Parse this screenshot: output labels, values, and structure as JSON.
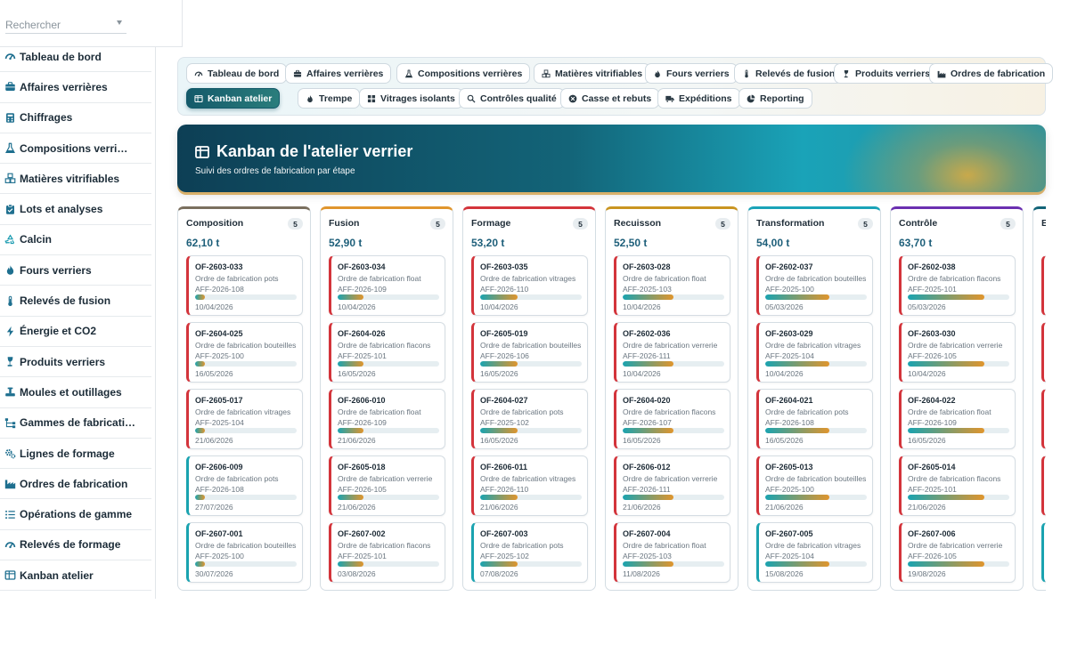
{
  "search": {
    "placeholder": "Rechercher"
  },
  "sidebar": {
    "items": [
      {
        "label": "Tableau de bord",
        "icon": "gauge-icon"
      },
      {
        "label": "Affaires verrières",
        "icon": "briefcase-icon"
      },
      {
        "label": "Chiffrages",
        "icon": "calculator-icon"
      },
      {
        "label": "Compositions verri…",
        "icon": "flask-icon"
      },
      {
        "label": "Matières vitrifiables",
        "icon": "cubes-icon"
      },
      {
        "label": "Lots et analyses",
        "icon": "clipboard-icon"
      },
      {
        "label": "Calcin",
        "icon": "recycle-icon"
      },
      {
        "label": "Fours verriers",
        "icon": "flame-icon"
      },
      {
        "label": "Relevés de fusion",
        "icon": "thermometer-icon"
      },
      {
        "label": "Énergie et CO2",
        "icon": "bolt-icon"
      },
      {
        "label": "Produits verriers",
        "icon": "wine-glass-icon"
      },
      {
        "label": "Moules et outillages",
        "icon": "tools-icon"
      },
      {
        "label": "Gammes de fabricati…",
        "icon": "sitemap-icon"
      },
      {
        "label": "Lignes de formage",
        "icon": "gears-icon"
      },
      {
        "label": "Ordres de fabrication",
        "icon": "industry-icon"
      },
      {
        "label": "Opérations de gamme",
        "icon": "list-icon"
      },
      {
        "label": "Relevés de formage",
        "icon": "gauge-icon"
      },
      {
        "label": "Kanban atelier",
        "icon": "kanban-icon"
      }
    ]
  },
  "tabs": [
    {
      "label": "Tableau de bord",
      "icon": "gauge-icon",
      "active": false
    },
    {
      "label": "Affaires verrières",
      "icon": "briefcase-icon",
      "active": false
    },
    {
      "label": "Compositions verrières",
      "icon": "flask-icon",
      "active": false
    },
    {
      "label": "Matières vitrifiables",
      "icon": "cubes-icon",
      "active": false
    },
    {
      "label": "Fours verriers",
      "icon": "flame-icon",
      "active": false
    },
    {
      "label": "Relevés de fusion",
      "icon": "thermometer-icon",
      "active": false
    },
    {
      "label": "Produits verriers",
      "icon": "wine-glass-icon",
      "active": false
    },
    {
      "label": "Ordres de fabrication",
      "icon": "industry-icon",
      "active": false
    },
    {
      "label": "Kanban atelier",
      "icon": "kanban-icon",
      "active": true
    },
    {
      "label": "Trempe",
      "icon": "flame-icon",
      "active": false
    },
    {
      "label": "Vitrages isolants",
      "icon": "grid-icon",
      "active": false
    },
    {
      "label": "Contrôles qualité",
      "icon": "search-icon",
      "active": false
    },
    {
      "label": "Casse et rebuts",
      "icon": "x-circle-icon",
      "active": false
    },
    {
      "label": "Expéditions",
      "icon": "truck-icon",
      "active": false
    },
    {
      "label": "Reporting",
      "icon": "pie-icon",
      "active": false
    }
  ],
  "hero": {
    "title": "Kanban de l'atelier verrier",
    "subtitle": "Suivi des ordres de fabrication par étape"
  },
  "columns": [
    {
      "name": "Composition",
      "count": "5",
      "total": "62,10 t",
      "color": "#7a6f5e",
      "cards": [
        {
          "id": "OF-2603-033",
          "desc": "Ordre de fabrication pots",
          "aff": "AFF-2026-108",
          "date": "10/04/2026",
          "status": "red",
          "progress": 0.1
        },
        {
          "id": "OF-2604-025",
          "desc": "Ordre de fabrication bouteilles",
          "aff": "AFF-2025-100",
          "date": "16/05/2026",
          "status": "red",
          "progress": 0.1
        },
        {
          "id": "OF-2605-017",
          "desc": "Ordre de fabrication vitrages",
          "aff": "AFF-2025-104",
          "date": "21/06/2026",
          "status": "red",
          "progress": 0.1
        },
        {
          "id": "OF-2606-009",
          "desc": "Ordre de fabrication pots",
          "aff": "AFF-2026-108",
          "date": "27/07/2026",
          "status": "teal",
          "progress": 0.1
        },
        {
          "id": "OF-2607-001",
          "desc": "Ordre de fabrication bouteilles",
          "aff": "AFF-2025-100",
          "date": "30/07/2026",
          "status": "teal",
          "progress": 0.1
        }
      ]
    },
    {
      "name": "Fusion",
      "count": "5",
      "total": "52,90 t",
      "color": "#e0952d",
      "cards": [
        {
          "id": "OF-2603-034",
          "desc": "Ordre de fabrication float",
          "aff": "AFF-2026-109",
          "date": "10/04/2026",
          "status": "red",
          "progress": 0.25
        },
        {
          "id": "OF-2604-026",
          "desc": "Ordre de fabrication flacons",
          "aff": "AFF-2025-101",
          "date": "16/05/2026",
          "status": "red",
          "progress": 0.25
        },
        {
          "id": "OF-2606-010",
          "desc": "Ordre de fabrication float",
          "aff": "AFF-2026-109",
          "date": "21/06/2026",
          "status": "red",
          "progress": 0.25
        },
        {
          "id": "OF-2605-018",
          "desc": "Ordre de fabrication verrerie",
          "aff": "AFF-2026-105",
          "date": "21/06/2026",
          "status": "red",
          "progress": 0.25
        },
        {
          "id": "OF-2607-002",
          "desc": "Ordre de fabrication flacons",
          "aff": "AFF-2025-101",
          "date": "03/08/2026",
          "status": "red",
          "progress": 0.25
        }
      ]
    },
    {
      "name": "Formage",
      "count": "5",
      "total": "53,20 t",
      "color": "#d3343b",
      "cards": [
        {
          "id": "OF-2603-035",
          "desc": "Ordre de fabrication vitrages",
          "aff": "AFF-2026-110",
          "date": "10/04/2026",
          "status": "red",
          "progress": 0.37
        },
        {
          "id": "OF-2605-019",
          "desc": "Ordre de fabrication bouteilles",
          "aff": "AFF-2026-106",
          "date": "16/05/2026",
          "status": "red",
          "progress": 0.37
        },
        {
          "id": "OF-2604-027",
          "desc": "Ordre de fabrication pots",
          "aff": "AFF-2025-102",
          "date": "16/05/2026",
          "status": "red",
          "progress": 0.37
        },
        {
          "id": "OF-2606-011",
          "desc": "Ordre de fabrication vitrages",
          "aff": "AFF-2026-110",
          "date": "21/06/2026",
          "status": "red",
          "progress": 0.37
        },
        {
          "id": "OF-2607-003",
          "desc": "Ordre de fabrication pots",
          "aff": "AFF-2025-102",
          "date": "07/08/2026",
          "status": "teal",
          "progress": 0.37
        }
      ]
    },
    {
      "name": "Recuisson",
      "count": "5",
      "total": "52,50 t",
      "color": "#c99420",
      "cards": [
        {
          "id": "OF-2603-028",
          "desc": "Ordre de fabrication float",
          "aff": "AFF-2025-103",
          "date": "10/04/2026",
          "status": "red",
          "progress": 0.5
        },
        {
          "id": "OF-2602-036",
          "desc": "Ordre de fabrication verrerie",
          "aff": "AFF-2026-111",
          "date": "10/04/2026",
          "status": "red",
          "progress": 0.5
        },
        {
          "id": "OF-2604-020",
          "desc": "Ordre de fabrication flacons",
          "aff": "AFF-2026-107",
          "date": "16/05/2026",
          "status": "red",
          "progress": 0.5
        },
        {
          "id": "OF-2606-012",
          "desc": "Ordre de fabrication verrerie",
          "aff": "AFF-2026-111",
          "date": "21/06/2026",
          "status": "red",
          "progress": 0.5
        },
        {
          "id": "OF-2607-004",
          "desc": "Ordre de fabrication float",
          "aff": "AFF-2025-103",
          "date": "11/08/2026",
          "status": "red",
          "progress": 0.5
        }
      ]
    },
    {
      "name": "Transformation",
      "count": "5",
      "total": "54,00 t",
      "color": "#1aa3b8",
      "cards": [
        {
          "id": "OF-2602-037",
          "desc": "Ordre de fabrication bouteilles",
          "aff": "AFF-2025-100",
          "date": "05/03/2026",
          "status": "red",
          "progress": 0.63
        },
        {
          "id": "OF-2603-029",
          "desc": "Ordre de fabrication vitrages",
          "aff": "AFF-2025-104",
          "date": "10/04/2026",
          "status": "red",
          "progress": 0.63
        },
        {
          "id": "OF-2604-021",
          "desc": "Ordre de fabrication pots",
          "aff": "AFF-2026-108",
          "date": "16/05/2026",
          "status": "red",
          "progress": 0.63
        },
        {
          "id": "OF-2605-013",
          "desc": "Ordre de fabrication bouteilles",
          "aff": "AFF-2025-100",
          "date": "21/06/2026",
          "status": "red",
          "progress": 0.63
        },
        {
          "id": "OF-2607-005",
          "desc": "Ordre de fabrication vitrages",
          "aff": "AFF-2025-104",
          "date": "15/08/2026",
          "status": "teal",
          "progress": 0.63
        }
      ]
    },
    {
      "name": "Contrôle",
      "count": "5",
      "total": "63,70 t",
      "color": "#6a2fb0",
      "cards": [
        {
          "id": "OF-2602-038",
          "desc": "Ordre de fabrication flacons",
          "aff": "AFF-2025-101",
          "date": "05/03/2026",
          "status": "red",
          "progress": 0.75
        },
        {
          "id": "OF-2603-030",
          "desc": "Ordre de fabrication verrerie",
          "aff": "AFF-2026-105",
          "date": "10/04/2026",
          "status": "red",
          "progress": 0.75
        },
        {
          "id": "OF-2604-022",
          "desc": "Ordre de fabrication float",
          "aff": "AFF-2026-109",
          "date": "16/05/2026",
          "status": "red",
          "progress": 0.75
        },
        {
          "id": "OF-2605-014",
          "desc": "Ordre de fabrication flacons",
          "aff": "AFF-2025-101",
          "date": "21/06/2026",
          "status": "red",
          "progress": 0.75
        },
        {
          "id": "OF-2607-006",
          "desc": "Ordre de fabrication verrerie",
          "aff": "AFF-2026-105",
          "date": "19/08/2026",
          "status": "red",
          "progress": 0.75
        }
      ]
    },
    {
      "name": "E",
      "count": "",
      "total": "",
      "color": "#136478",
      "cards": [
        {
          "id": "",
          "desc": "",
          "aff": "",
          "date": "",
          "status": "red",
          "progress": 0
        },
        {
          "id": "",
          "desc": "",
          "aff": "",
          "date": "",
          "status": "red",
          "progress": 0
        },
        {
          "id": "",
          "desc": "",
          "aff": "",
          "date": "",
          "status": "red",
          "progress": 0
        },
        {
          "id": "",
          "desc": "",
          "aff": "",
          "date": "",
          "status": "red",
          "progress": 0
        },
        {
          "id": "",
          "desc": "",
          "aff": "",
          "date": "",
          "status": "teal",
          "progress": 0
        }
      ]
    }
  ]
}
